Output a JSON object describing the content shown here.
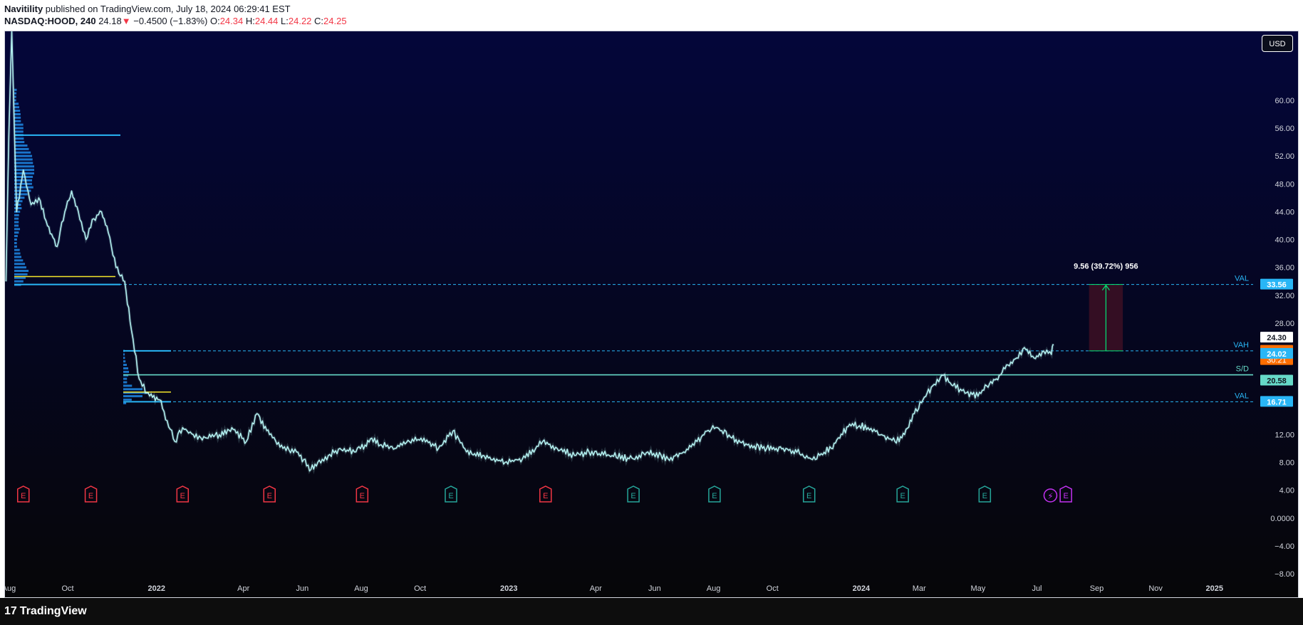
{
  "header": {
    "author": "Navitility",
    "published_text": " published on TradingView.com, July 18, 2024 06:29:41 EST",
    "symbol": "NASDAQ:HOOD, 240",
    "last": "24.18",
    "change_arrow": "▼",
    "change": "−0.4500 (−1.83%)",
    "o_label": "O:",
    "o_value": "24.34",
    "h_label": "H:",
    "h_value": "24.44",
    "l_label": "L:",
    "l_value": "24.22",
    "c_label": "C:",
    "c_value": "24.25"
  },
  "toolbar": {
    "currency_label": "USD"
  },
  "footer": {
    "logo_mark": "17",
    "logo_text": "TradingView"
  },
  "colors": {
    "bg_top": "#04063a",
    "bg_bottom": "#060608",
    "price_line": "#b3f0ef",
    "level_blue": "#29b6f6",
    "sd_line": "#66d9c8",
    "volume_blue": "#1e88e5",
    "poc_yellow": "#f5e52a",
    "earnings_red": "#f23645",
    "earnings_teal": "#26a69a",
    "measure_fill": "#3a0f24",
    "measure_green": "#00e676",
    "event_purple": "#c432f2",
    "axis_text": "#d1d4dc"
  },
  "chart_data": {
    "type": "line",
    "symbol": "NASDAQ:HOOD",
    "interval": "240",
    "currency": "USD",
    "yticks": [
      60.0,
      56.0,
      52.0,
      48.0,
      44.0,
      40.0,
      36.0,
      32.0,
      28.0,
      12.0,
      8.0,
      4.0,
      0.0,
      -4.0,
      -8.0
    ],
    "ylim": [
      -8.4,
      64.6
    ],
    "x_tick_labels": [
      "Aug",
      "Oct",
      "2022",
      "Apr",
      "Jun",
      "Aug",
      "Oct",
      "2023",
      "Apr",
      "Jun",
      "Aug",
      "Oct",
      "2024",
      "Mar",
      "May",
      "Jul",
      "Sep",
      "Nov",
      "2025"
    ],
    "x_tick_dates": [
      "2021-08-01",
      "2021-10-01",
      "2022-01-01",
      "2022-04-01",
      "2022-06-01",
      "2022-08-01",
      "2022-10-01",
      "2023-01-01",
      "2023-04-01",
      "2023-06-01",
      "2023-08-01",
      "2023-10-01",
      "2024-01-01",
      "2024-03-01",
      "2024-05-01",
      "2024-07-01",
      "2024-09-01",
      "2024-11-01",
      "2025-01-01"
    ],
    "xlim": [
      "2021-07-28",
      "2025-02-10"
    ],
    "series": [
      {
        "x": [
          "2021-07-29",
          "2021-08-01",
          "2021-08-04",
          "2021-08-09",
          "2021-08-16",
          "2021-08-24",
          "2021-09-01",
          "2021-09-10",
          "2021-09-20",
          "2021-09-28",
          "2021-10-05",
          "2021-10-12",
          "2021-10-20",
          "2021-10-28",
          "2021-11-05",
          "2021-11-12",
          "2021-11-20",
          "2021-11-29",
          "2021-12-06",
          "2021-12-14",
          "2021-12-22",
          "2022-01-04",
          "2022-01-12",
          "2022-01-20",
          "2022-01-28",
          "2022-02-08",
          "2022-02-22",
          "2022-03-07",
          "2022-03-20",
          "2022-04-04",
          "2022-04-15",
          "2022-04-28",
          "2022-05-12",
          "2022-05-26",
          "2022-06-10",
          "2022-06-17",
          "2022-06-28",
          "2022-07-10",
          "2022-07-25",
          "2022-08-05",
          "2022-08-12",
          "2022-08-22",
          "2022-09-05",
          "2022-09-20",
          "2022-10-05",
          "2022-10-20",
          "2022-11-04",
          "2022-11-18",
          "2022-12-05",
          "2022-12-28",
          "2023-01-15",
          "2023-02-05",
          "2023-02-20",
          "2023-03-10",
          "2023-03-25",
          "2023-04-15",
          "2023-05-10",
          "2023-05-25",
          "2023-06-15",
          "2023-07-01",
          "2023-07-15",
          "2023-07-25",
          "2023-08-05",
          "2023-08-20",
          "2023-09-05",
          "2023-09-25",
          "2023-10-15",
          "2023-11-01",
          "2023-11-10",
          "2023-12-01",
          "2023-12-20",
          "2024-01-08",
          "2024-01-22",
          "2024-02-05",
          "2024-02-15",
          "2024-02-25",
          "2024-03-05",
          "2024-03-15",
          "2024-03-26",
          "2024-04-05",
          "2024-04-19",
          "2024-05-01",
          "2024-05-10",
          "2024-05-20",
          "2024-06-01",
          "2024-06-10",
          "2024-06-18",
          "2024-06-28",
          "2024-07-08",
          "2024-07-16",
          "2024-07-18"
        ],
        "values": [
          34.0,
          55.0,
          70.0,
          44.0,
          50.0,
          45.0,
          46.0,
          42.0,
          39.0,
          44.0,
          47.0,
          44.0,
          40.0,
          43.0,
          44.0,
          41.0,
          36.0,
          34.0,
          27.0,
          20.0,
          18.0,
          17.0,
          14.0,
          11.0,
          13.0,
          12.0,
          11.5,
          12.0,
          13.0,
          11.0,
          15.0,
          12.0,
          10.0,
          9.5,
          7.0,
          8.0,
          9.0,
          10.0,
          9.5,
          10.5,
          11.5,
          10.5,
          10.0,
          11.0,
          11.5,
          10.0,
          12.5,
          9.5,
          9.0,
          8.0,
          8.5,
          11.0,
          10.0,
          9.0,
          9.5,
          9.0,
          8.5,
          9.5,
          8.5,
          9.5,
          11.0,
          12.5,
          13.0,
          11.5,
          10.5,
          10.0,
          10.0,
          9.2,
          8.5,
          10.0,
          13.5,
          13.0,
          12.0,
          11.0,
          12.0,
          15.0,
          17.0,
          19.0,
          20.5,
          19.0,
          18.0,
          17.5,
          19.0,
          20.0,
          22.0,
          23.0,
          24.5,
          23.0,
          24.0,
          23.5,
          25.0
        ]
      }
    ],
    "levels": [
      {
        "label": "VAL",
        "value": 33.56,
        "value_label": "33.56",
        "style": "dashed"
      },
      {
        "label": "VAH",
        "value": 24.02,
        "value_label": "",
        "style": "dashed"
      },
      {
        "label": "S/D",
        "value": 20.58,
        "value_label": "",
        "style": "solid"
      },
      {
        "label": "VAL",
        "value": 16.71,
        "value_label": "16.71",
        "style": "dashed"
      }
    ],
    "price_labels": [
      {
        "value": 24.3,
        "text": "24.30",
        "kind": "high"
      },
      {
        "value": 24.25,
        "text": "24.25",
        "kind": "last"
      },
      {
        "value": 24.02,
        "text": "24.02",
        "kind": "level"
      },
      {
        "value": 20.58,
        "text": "20.58",
        "kind": "sd"
      }
    ],
    "countdown": "30:21",
    "measure": {
      "label": "9.56 (39.72%) 956",
      "from_value": 24.02,
      "to_value": 33.56,
      "start_date": "2024-08-24",
      "end_date": "2024-09-28"
    },
    "earnings": [
      {
        "date": "2021-08-16",
        "type": "E",
        "result": "miss"
      },
      {
        "date": "2021-10-25",
        "type": "E",
        "result": "miss"
      },
      {
        "date": "2022-01-28",
        "type": "E",
        "result": "miss"
      },
      {
        "date": "2022-04-28",
        "type": "E",
        "result": "miss"
      },
      {
        "date": "2022-08-02",
        "type": "E",
        "result": "miss"
      },
      {
        "date": "2022-11-02",
        "type": "E",
        "result": "beat"
      },
      {
        "date": "2023-02-08",
        "type": "E",
        "result": "miss"
      },
      {
        "date": "2023-05-10",
        "type": "E",
        "result": "beat"
      },
      {
        "date": "2023-08-02",
        "type": "E",
        "result": "beat"
      },
      {
        "date": "2023-11-08",
        "type": "E",
        "result": "beat"
      },
      {
        "date": "2024-02-13",
        "type": "E",
        "result": "beat"
      },
      {
        "date": "2024-05-08",
        "type": "E",
        "result": "beat"
      },
      {
        "date": "2024-07-15",
        "type": "⚡",
        "result": "event"
      },
      {
        "date": "2024-07-31",
        "type": "E",
        "result": "upcoming"
      }
    ],
    "legend": "none",
    "grid": false
  }
}
